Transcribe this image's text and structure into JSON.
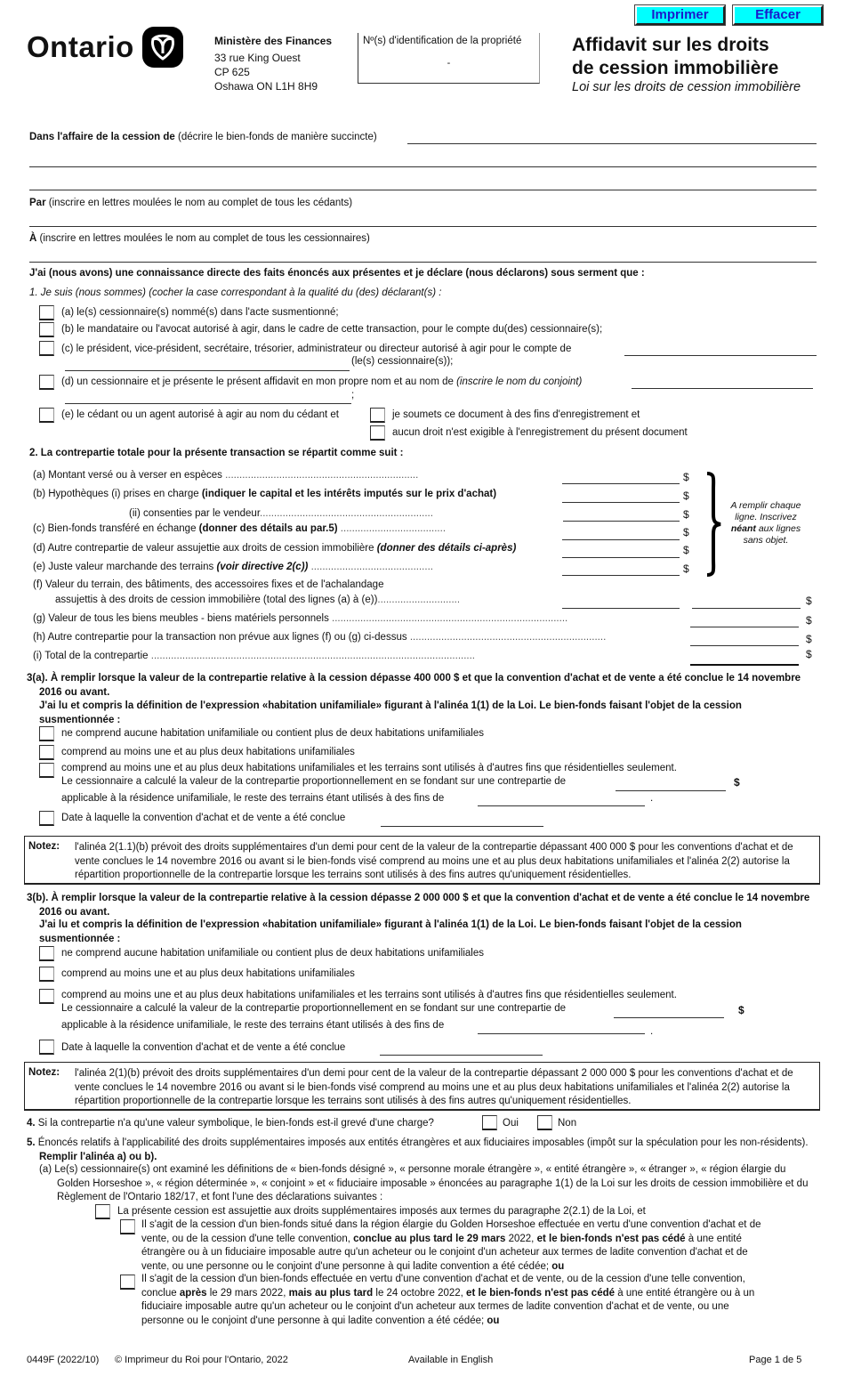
{
  "header": {
    "logo_text": "Ontario",
    "ministry": "Ministère des Finances",
    "address": [
      "33 rue King Ouest",
      "CP 625",
      "Oshawa ON  L1H 8H9"
    ],
    "pin_label": "Nº(s) d'identification de la propriété",
    "pin_value": "-",
    "title_line1": "Affidavit sur les droits",
    "title_line2": "de cession immobilière",
    "subtitle": "Loi sur les droits de cession immobilière",
    "print_button": "Imprimer",
    "clear_button": "Effacer"
  },
  "intro": {
    "matter_label_bold": "Dans l'affaire de la cession de",
    "matter_label_rest": " (décrire le bien-fonds de manière succincte)",
    "by_label_bold": "Par",
    "by_label_rest": " (inscrire en lettres moulées le nom au complet de tous les cédants)",
    "to_label_bold": "À",
    "to_label_rest": " (inscrire en lettres moulées le nom au complet de tous les cessionnaires)",
    "oath": "J'ai (nous avons) une connaissance directe des faits énoncés aux présentes et je déclare (nous déclarons) sous serment que :"
  },
  "section1": {
    "heading": "1. Je suis (nous sommes) (cocher la case correspondant à la qualité du (des) déclarant(s) :",
    "a": "(a) le(s) cessionnaire(s) nommé(s) dans l'acte susmentionné;",
    "b": "(b) le mandataire ou l'avocat autorisé à agir, dans le cadre de cette transaction, pour le compte du(des) cessionnaire(s);",
    "c": "(c) le président, vice-président, secrétaire, trésorier, administrateur ou directeur autorisé à agir pour le compte de",
    "c_suffix": "(le(s) cessionnaire(s));",
    "d": "(d) un cessionnaire et je présente le présent affidavit en mon propre nom et au nom de ",
    "d_italic": "(inscrire le nom du conjoint)",
    "d_suffix": ";",
    "e": "(e) le cédant ou un agent autorisé à agir au nom du cédant et",
    "e1": "je soumets ce document à des fins d'enregistrement et",
    "e2": "aucun droit n'est exigible à l'enregistrement du présent document"
  },
  "section2": {
    "heading": "2. La contrepartie totale pour la présente transaction se répartit comme suit :",
    "currency": "$",
    "a": "(a) Montant versé ou à verser en espèces ",
    "b_prefix": "(b) Hypothèques   (i) prises en charge ",
    "b_bold": "(indiquer le capital et les intérêts imputés sur le prix d'achat)",
    "b2": "(ii) consenties par le vendeur",
    "c_prefix": "(c) Bien-fonds transféré en échange ",
    "c_bold": "(donner des détails au par.5)",
    "d_prefix": "(d) Autre contrepartie de valeur assujettie aux droits de cession immobilière ",
    "d_bold": "(donner des détails ci-après)",
    "e_prefix": "(e) Juste valeur marchande des terrains ",
    "e_bold": "(voir directive 2(c))",
    "f1": "(f)  Valeur du terrain, des bâtiments, des accessoires fixes et de l'achalandage",
    "f2": "assujettis à des droits de cession immobilière (total des lignes (a) à (e))",
    "g": "(g) Valeur de tous les biens meubles - biens matériels personnels ",
    "h": "(h) Autre contrepartie pour la transaction non prévue aux lignes (f) ou (g) ci-dessus ",
    "i": "(i)  Total de la contrepartie ",
    "side_note_1": "A remplir chaque ligne. Inscrivez ",
    "side_note_bold": "néant",
    "side_note_2": " aux lignes sans objet."
  },
  "section3a": {
    "heading": "3(a). À remplir lorsque la valeur de la contrepartie relative à la cession dépasse 400 000 $ et que la convention d'achat et de vente a été conclue le 14 novembre 2016 ou avant.",
    "subheading": "J'ai lu et compris la définition de l'expression «habitation unifamiliale» figurant à l'alinéa 1(1) de la Loi. Le bien-fonds faisant l'objet de la cession susmentionnée :",
    "opt1": "ne comprend aucune habitation unifamiliale ou contient plus de deux habitations unifamiliales",
    "opt2": "comprend au moins une et au plus deux habitations unifamiliales",
    "opt3": "comprend au moins une et au plus deux habitations unifamiliales et les terrains sont utilisés à d'autres fins que résidentielles seulement.",
    "opt3_line2": "Le cessionnaire a calculé la valeur de la contrepartie proportionnellement en se fondant sur une contrepartie de",
    "opt3_line3": "applicable à la résidence unifamiliale, le reste des terrains étant utilisés à des fins de",
    "opt4": "Date à laquelle la convention d'achat et de vente a été conclue",
    "note_label": "Notez:",
    "note": "l'alinéa 2(1.1)(b) prévoit des droits supplémentaires d'un demi pour cent de la valeur de la contrepartie dépassant 400 000 $ pour les conventions d'achat et de vente conclues le 14 novembre 2016 ou avant si le bien-fonds visé comprend au moins une et au plus deux habitations unifamiliales et l'alinéa 2(2) autorise la répartition proportionnelle de la contrepartie lorsque les terrains sont utilisés à des fins autres qu'uniquement résidentielles."
  },
  "section3b": {
    "heading": "3(b). À remplir lorsque la valeur de la contrepartie relative à la cession dépasse 2 000 000 $ et que la convention d'achat et de vente a été conclue le 14 novembre 2016 ou avant.",
    "subheading": "J'ai lu et compris la définition de l'expression «habitation unifamiliale» figurant à l'alinéa 1(1) de la Loi. Le bien-fonds faisant l'objet de la cession susmentionnée :",
    "opt1": "ne comprend aucune habitation unifamiliale ou contient plus de deux habitations unifamiliales",
    "opt2": "comprend au moins une et au plus deux habitations unifamiliales",
    "opt3": "comprend au moins une et au plus deux habitations unifamiliales et les terrains sont utilisés à d'autres fins que résidentielles seulement.",
    "opt3_line2": "Le cessionnaire a calculé la valeur de la contrepartie proportionnellement en se fondant sur une contrepartie de",
    "opt3_line3": "applicable à la résidence unifamiliale, le reste des terrains étant utilisés à des fins de",
    "opt4": "Date à laquelle la convention d'achat et de vente a été conclue",
    "note_label": "Notez:",
    "note": "l'alinéa 2(1)(b) prévoit des droits supplémentaires d'un demi pour cent de la valeur de la contrepartie dépassant 2 000 000 $ pour les conventions d'achat et de vente conclues le 14 novembre 2016 ou avant si le bien-fonds visé comprend au moins une et au plus deux habitations unifamiliales et l'alinéa 2(2) autorise la répartition proportionnelle de la contrepartie lorsque les terrains sont utilisés à des fins autres qu'uniquement résidentielles."
  },
  "section4": {
    "num": "4.",
    "question": " Si la contrepartie n'a qu'une valeur symbolique, le bien-fonds est-il grevé d'une charge?",
    "yes": "Oui",
    "no": "Non"
  },
  "section5": {
    "num": "5.",
    "intro": "  Énoncés relatifs à l'applicabilité des droits supplémentaires imposés aux entités étrangères et aux fiduciaires imposables (impôt sur la spéculation pour les non-résidents). ",
    "intro_bold": "Remplir l'alinéa a) ou b).",
    "a": "(a) Le(s) cessionnaire(s) ont examiné les définitions de « bien-fonds désigné », « personne morale étrangère », « entité étrangère », « étranger », « région élargie du Golden Horseshoe », « région déterminée », « conjoint » et « fiduciaire imposable » énoncées au paragraphe 1(1) de la Loi sur les droits de cession immobilière et du Règlement de l'Ontario 182/17, et font l'une des déclarations suivantes :",
    "subject": "La présente cession est assujettie aux droits supplémentaires imposés aux termes du paragraphe 2(2.1) de la Loi, et",
    "opt1_p1": "Il s'agit de la cession d'un bien-fonds situé dans la région élargie du Golden Horseshoe effectuée en vertu d'une convention d'achat et de vente, ou de la cession d'une telle convention, ",
    "opt1_b1": "conclue au plus tard le 29 mars",
    "opt1_p2": " 2022, ",
    "opt1_b2": "et le bien-fonds n'est pas cédé",
    "opt1_p3": " à une entité étrangère ou à un fiduciaire imposable autre qu'un acheteur ou le conjoint d'un acheteur aux termes de ladite convention d'achat et de vente, ou une personne ou le conjoint d'une personne à qui ladite convention a été cédée; ",
    "opt1_b3": "ou",
    "opt2_p1": "Il s'agit de la cession d'un bien-fonds effectuée en vertu d'une convention d'achat et de vente, ou de la cession d'une telle convention, conclue ",
    "opt2_b1": "après",
    "opt2_p2": " le 29 mars 2022, ",
    "opt2_b2": "mais au plus tard",
    "opt2_p3": " le 24 octobre 2022, ",
    "opt2_b3": "et le bien-fonds n'est pas cédé",
    "opt2_p4": " à une entité étrangère ou à un fiduciaire imposable autre qu'un acheteur ou le conjoint d'un acheteur aux termes de ladite convention d'achat et de vente, ou une personne ou le conjoint d'une personne à qui ladite convention a été cédée; ",
    "opt2_b4": "ou"
  },
  "footer": {
    "form_number": "0449F (2022/10)",
    "copyright": "© Imprimeur du Roi pour l'Ontario, 2022",
    "available": "Available in English",
    "page": "Page 1 de 5"
  }
}
